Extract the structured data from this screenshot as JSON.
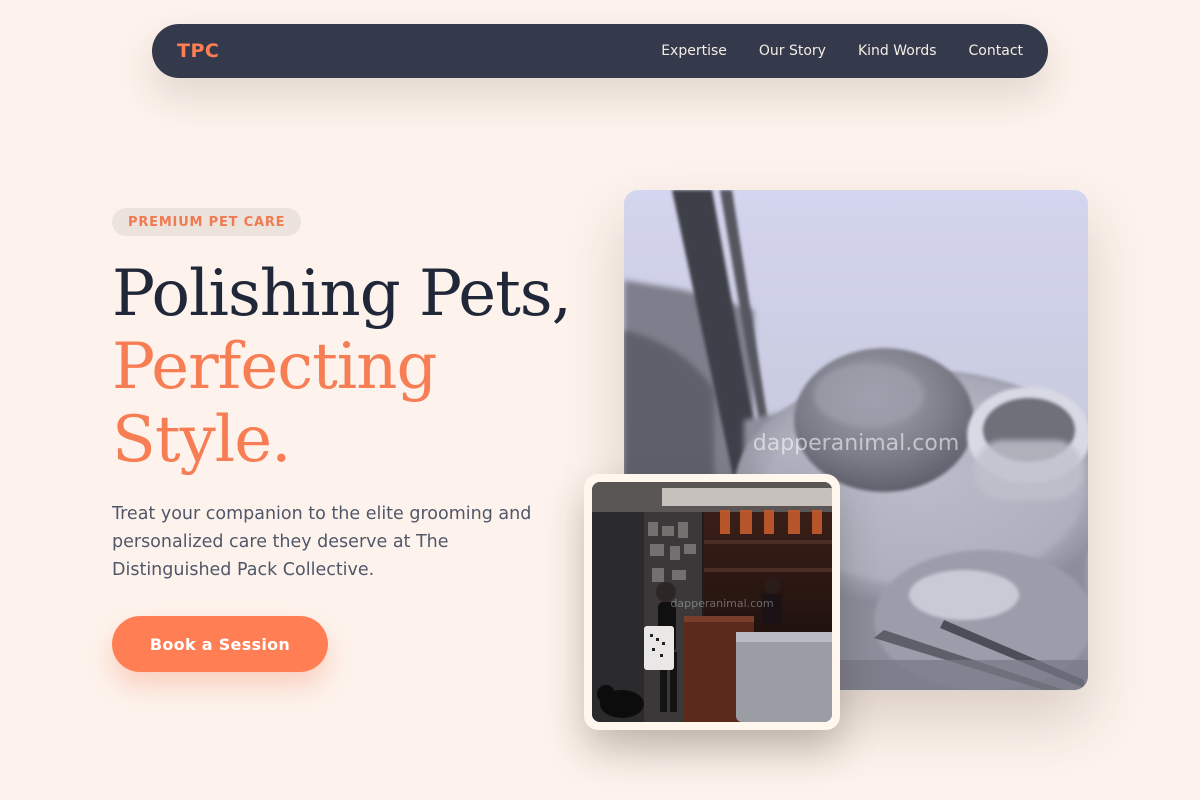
{
  "nav": {
    "logo": "TPC",
    "links": [
      "Expertise",
      "Our Story",
      "Kind Words",
      "Contact"
    ]
  },
  "hero": {
    "badge": "PREMIUM PET CARE",
    "headline_line1": "Polishing Pets,",
    "headline_line2": "Perfecting",
    "headline_line3": "Style.",
    "subtitle": "Treat your companion to the elite grooming and personalized care they deserve at The Distinguished Pack Collective.",
    "cta_label": "Book a Session"
  },
  "images": {
    "main_watermark": "dapperanimal.com",
    "small_watermark": "dapperanimal.com"
  },
  "colors": {
    "background": "#fdf3ec",
    "nav_bg": "#343a4b",
    "accent": "#ff7e54",
    "heading": "#1f2738",
    "body_text": "#50576a"
  }
}
